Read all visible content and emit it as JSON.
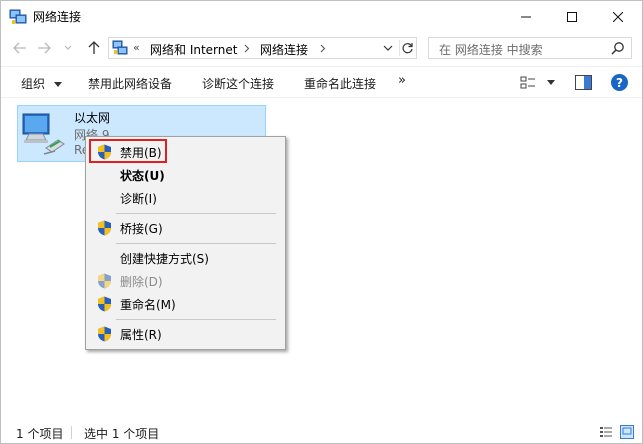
{
  "window": {
    "title": "网络连接"
  },
  "address": {
    "chevrons": "«",
    "crumbs": [
      "网络和 Internet",
      "网络连接"
    ]
  },
  "search": {
    "placeholder": "在 网络连接 中搜索"
  },
  "commands": {
    "organize": "组织",
    "disable_device": "禁用此网络设备",
    "diagnose": "诊断这个连接",
    "rename": "重命名此连接",
    "more": "»",
    "help": "?"
  },
  "item": {
    "name": "以太网",
    "network": "网络 9",
    "adapter_partial": "Re"
  },
  "context_menu": {
    "items": [
      {
        "label": "禁用(B)",
        "shield": true,
        "bold": false,
        "disabled": false
      },
      {
        "label": "状态(U)",
        "shield": false,
        "bold": true,
        "disabled": false
      },
      {
        "label": "诊断(I)",
        "shield": false,
        "bold": false,
        "disabled": false
      },
      {
        "label": "桥接(G)",
        "shield": true,
        "bold": false,
        "disabled": false
      },
      {
        "label": "创建快捷方式(S)",
        "shield": false,
        "bold": false,
        "disabled": false
      },
      {
        "label": "删除(D)",
        "shield": true,
        "bold": false,
        "disabled": true
      },
      {
        "label": "重命名(M)",
        "shield": true,
        "bold": false,
        "disabled": false
      },
      {
        "label": "属性(R)",
        "shield": true,
        "bold": false,
        "disabled": false
      }
    ]
  },
  "status": {
    "count": "1 个项目",
    "selected": "选中 1 个项目"
  },
  "colors": {
    "selection": "#cce8ff",
    "highlight_border": "#e02020",
    "menu_bg": "#f2f2f2",
    "help_blue": "#1a66c8"
  }
}
